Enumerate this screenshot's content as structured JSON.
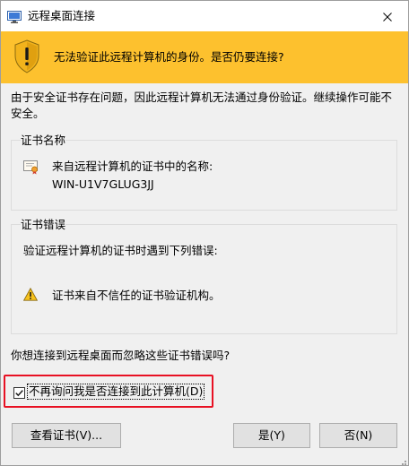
{
  "window": {
    "title": "远程桌面连接"
  },
  "banner": {
    "text": "无法验证此远程计算机的身份。是否仍要连接?"
  },
  "description": "由于安全证书存在问题，因此远程计算机无法通过身份验证。继续操作可能不安全。",
  "cert_name_group": {
    "title": "证书名称",
    "label": "来自远程计算机的证书中的名称:",
    "value": "WIN-U1V7GLUG3JJ"
  },
  "cert_error_group": {
    "title": "证书错误",
    "label": "验证远程计算机的证书时遇到下列错误:",
    "errors": [
      "证书来自不信任的证书验证机构。"
    ]
  },
  "question": "你想连接到远程桌面而忽略这些证书错误吗?",
  "checkbox": {
    "label": "不再询问我是否连接到此计算机(D)",
    "checked": true
  },
  "buttons": {
    "view_cert": "查看证书(V)...",
    "yes": "是(Y)",
    "no": "否(N)"
  },
  "colors": {
    "banner": "#fdc12e",
    "highlight_border": "#e81123",
    "dialog_background": "#f0f0f0"
  }
}
